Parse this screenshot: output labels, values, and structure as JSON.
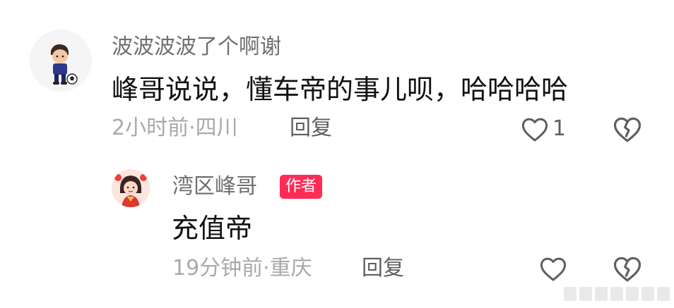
{
  "comments": [
    {
      "username": "波波波波了个啊谢",
      "text": "峰哥说说，懂车帝的事儿呗，哈哈哈哈",
      "meta": "2小时前·四川",
      "reply_label": "回复",
      "like_count": "1",
      "avatar_icon": "boy-soccer-avatar",
      "like_icon": "heart-outline-icon",
      "dislike_icon": "broken-heart-icon"
    },
    {
      "username": "湾区峰哥",
      "badge": "作者",
      "text": "充值帝",
      "meta": "19分钟前·重庆",
      "reply_label": "回复",
      "avatar_icon": "cartoon-girl-avatar",
      "like_icon": "heart-outline-icon",
      "dislike_icon": "broken-heart-icon"
    }
  ],
  "colors": {
    "username": "#6f6f73",
    "text": "#111111",
    "meta": "#a9a9ad",
    "badge_bg": "#fe2c55",
    "badge_text": "#ffffff",
    "icon": "#5e5e62"
  }
}
